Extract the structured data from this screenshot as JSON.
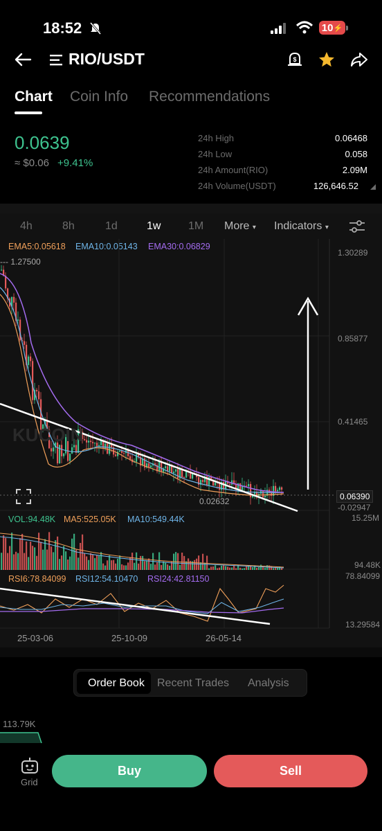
{
  "status_bar": {
    "time": "18:52",
    "battery": "10"
  },
  "header": {
    "title": "RIO/USDT"
  },
  "tabs": [
    "Chart",
    "Coin Info",
    "Recommendations"
  ],
  "ticker": {
    "price": "0.0639",
    "fiat": "≈ $0.06",
    "change": "+9.41%",
    "stats": [
      {
        "label": "24h High",
        "value": "0.06468"
      },
      {
        "label": "24h Low",
        "value": "0.058"
      },
      {
        "label": "24h Amount(RIO)",
        "value": "2.09M"
      },
      {
        "label": "24h Volume(USDT)",
        "value": "126,646.52"
      }
    ]
  },
  "intervals": [
    "4h",
    "8h",
    "1d",
    "1w",
    "1M"
  ],
  "interval_more": "More",
  "interval_indicators": "Indicators",
  "chart": {
    "ema": {
      "ema5": "EMA5:0.05618",
      "ema10": "EMA10:0.05143",
      "ema30": "EMA30:0.06829"
    },
    "high_marker": "1.27500",
    "low_marker": "0.02632",
    "price_axis": [
      "1.30289",
      "0.85877",
      "0.41465",
      "-0.02947"
    ],
    "last_price": "0.06390",
    "vol": {
      "vol": "VOL:94.48K",
      "ma5": "MA5:525.05K",
      "ma10": "MA10:549.44K"
    },
    "vol_axis": [
      "15.25M",
      "94.48K"
    ],
    "rsi": {
      "rsi6": "RSI6:78.84099",
      "rsi12": "RSI12:54.10470",
      "rsi24": "RSI24:42.81150"
    },
    "rsi_axis": [
      "78.84099",
      "13.29584"
    ],
    "dates": [
      "25-03-06",
      "25-10-09",
      "26-05-14"
    ],
    "colors": {
      "up": "#3ec38f",
      "down": "#e45a5a",
      "ema5": "#f0a05a",
      "ema10": "#6fb5e8",
      "ema30": "#a46cf0"
    }
  },
  "order_tabs": [
    "Order Book",
    "Recent Trades",
    "Analysis"
  ],
  "depth_value": "113.79K",
  "actions": {
    "grid": "Grid",
    "buy": "Buy",
    "sell": "Sell"
  }
}
